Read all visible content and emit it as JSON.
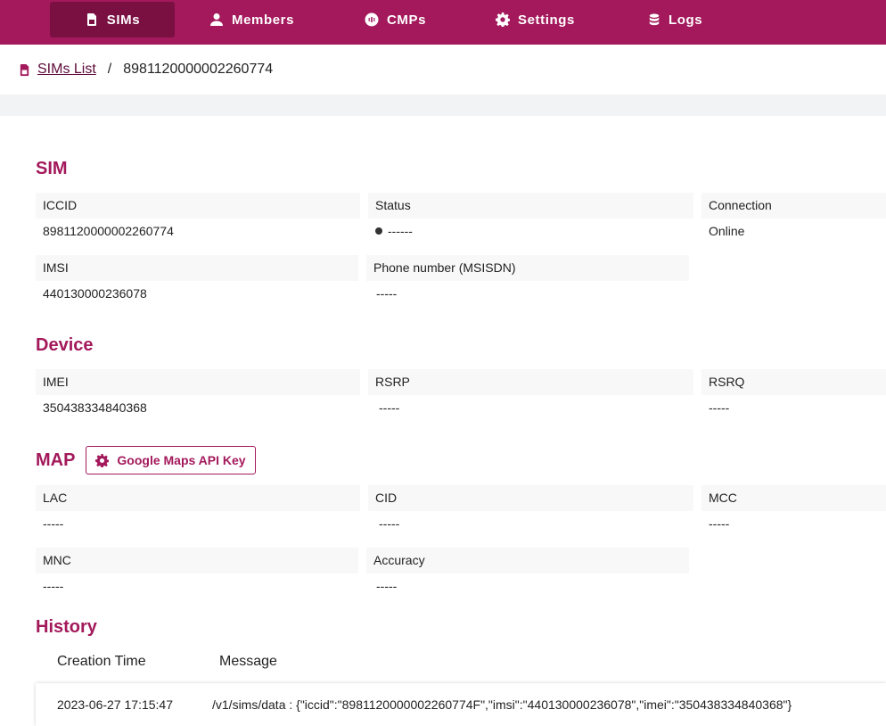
{
  "nav": {
    "tabs": [
      {
        "label": "SIMs",
        "icon": "sim-card-icon",
        "active": true
      },
      {
        "label": "Members",
        "icon": "person-icon"
      },
      {
        "label": "CMPs",
        "icon": "broadcast-icon"
      },
      {
        "label": "Settings",
        "icon": "gear-icon"
      },
      {
        "label": "Logs",
        "icon": "database-icon"
      }
    ]
  },
  "breadcrumb": {
    "link": "SIMs List",
    "separator": "/",
    "current": "8981120000002260774"
  },
  "sim": {
    "title": "SIM",
    "iccid_label": "ICCID",
    "iccid_value": "8981120000002260774",
    "status_label": "Status",
    "status_value": "------",
    "connection_label": "Connection",
    "connection_value": "Online",
    "imsi_label": "IMSI",
    "imsi_value": "440130000236078",
    "phone_label": "Phone number (MSISDN)",
    "phone_value": "-----"
  },
  "device": {
    "title": "Device",
    "imei_label": "IMEI",
    "imei_value": "350438334840368",
    "rsrp_label": "RSRP",
    "rsrp_value": "-----",
    "rsrq_label": "RSRQ",
    "rsrq_value": "-----"
  },
  "map": {
    "title": "MAP",
    "api_key_button": "Google Maps API Key",
    "lac_label": "LAC",
    "lac_value": "-----",
    "cid_label": "CID",
    "cid_value": "-----",
    "mcc_label": "MCC",
    "mcc_value": "-----",
    "mnc_label": "MNC",
    "mnc_value": "-----",
    "accuracy_label": "Accuracy",
    "accuracy_value": "-----"
  },
  "history": {
    "title": "History",
    "columns": [
      "Creation Time",
      "Message"
    ],
    "rows": [
      {
        "time": "2023-06-27 17:15:47",
        "message": "/v1/sims/data : {\"iccid\":\"8981120000002260774F\",\"imsi\":\"440130000236078\",\"imei\":\"350438334840368\"}"
      }
    ]
  },
  "colors": {
    "brand": "#a3195b",
    "brand_dark": "#7a0f42"
  }
}
